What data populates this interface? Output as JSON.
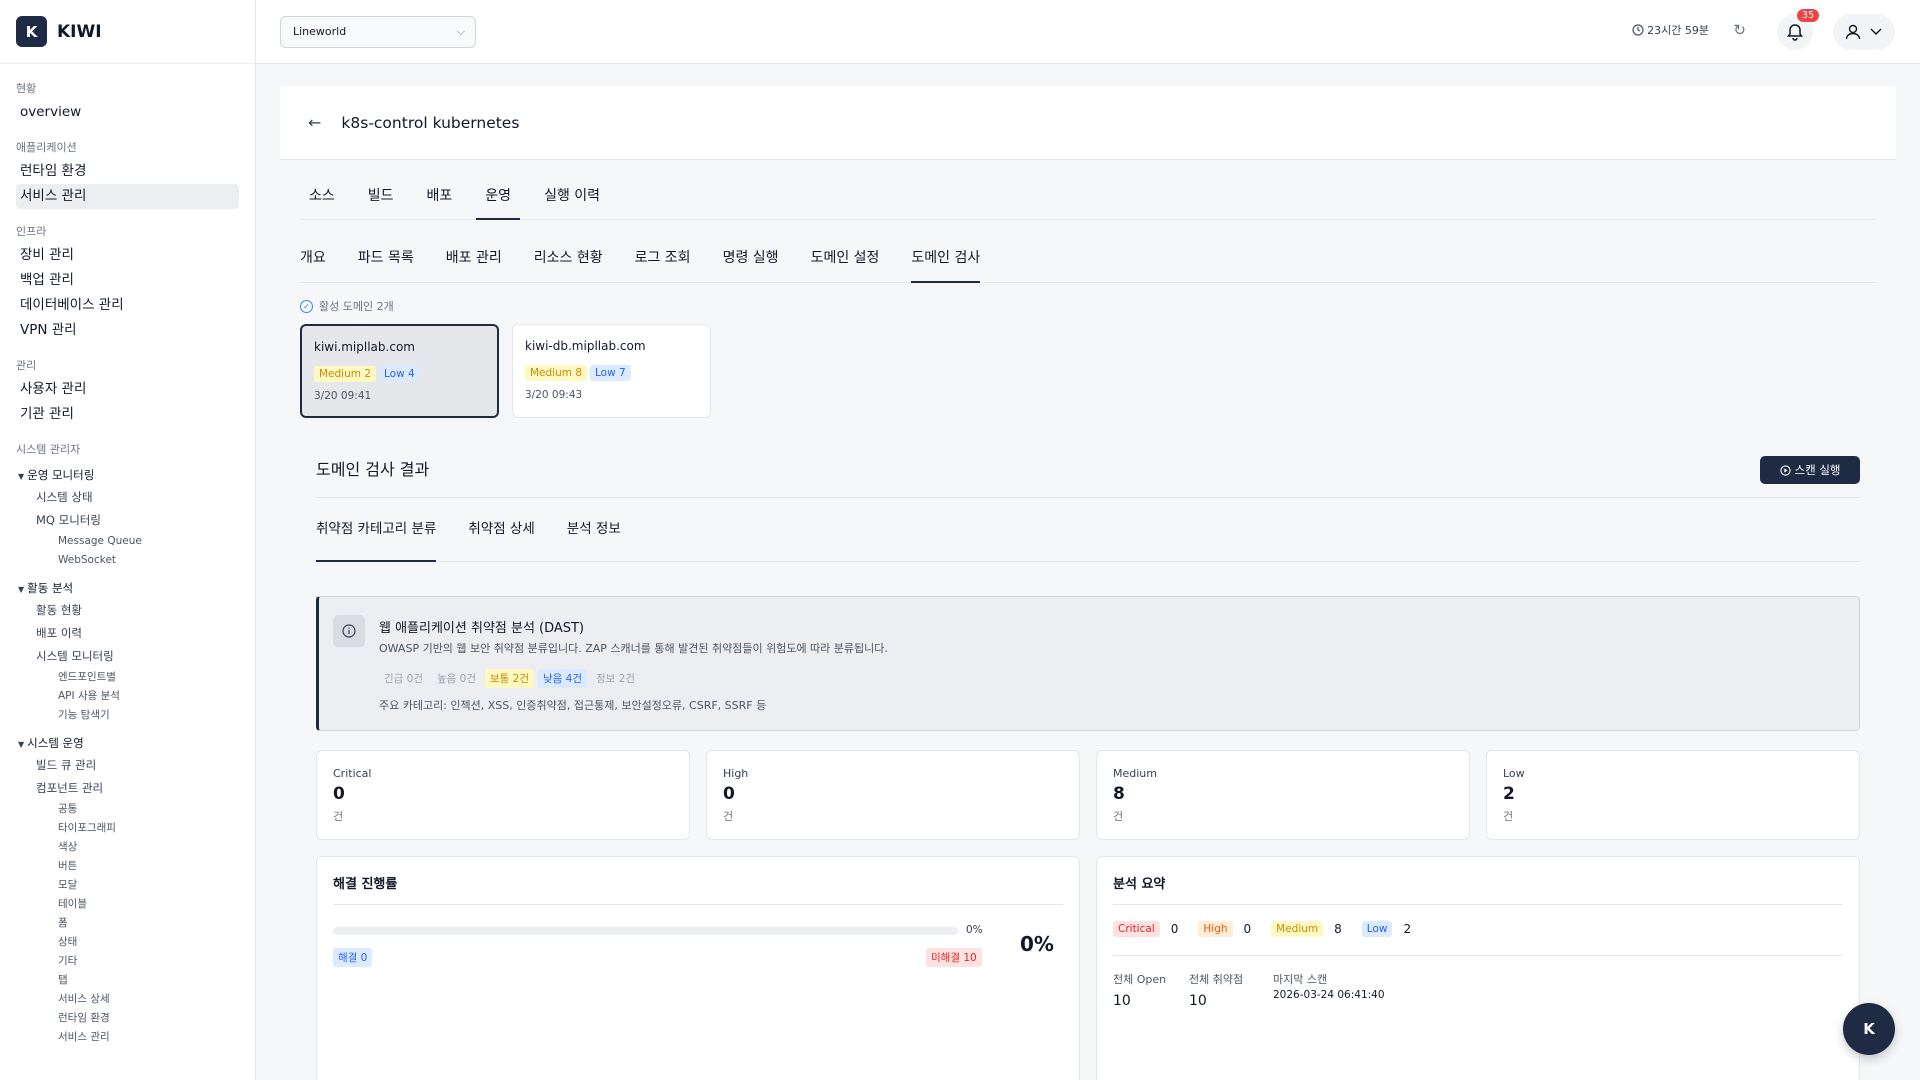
{
  "app": {
    "logo_letter": "K",
    "name": "KIWI"
  },
  "sidebar": {
    "sections": [
      {
        "label": "현황",
        "items": [
          "overview"
        ]
      },
      {
        "label": "애플리케이션",
        "items": [
          "런타임 환경",
          "서비스 관리"
        ]
      },
      {
        "label": "인프라",
        "items": [
          "장비 관리",
          "백업 관리",
          "데이터베이스 관리",
          "VPN 관리"
        ]
      },
      {
        "label": "관리",
        "items": [
          "사용자 관리",
          "기관 관리"
        ]
      }
    ],
    "admin_label": "시스템 관리자",
    "groups": [
      {
        "label": "운영 모니터링",
        "subs": [
          "시스템 상태",
          "MQ 모니터링"
        ],
        "subsubs": [
          "Message Queue",
          "WebSocket"
        ]
      },
      {
        "label": "활동 분석",
        "subs": [
          "활동 현황",
          "배포 이력",
          "시스템 모니터링"
        ],
        "subsubs": [
          "엔드포인트별",
          "API 사용 분석",
          "기능 탐색기"
        ]
      },
      {
        "label": "시스템 운영",
        "subs": [
          "빌드 큐 관리",
          "컴포넌트 관리"
        ],
        "subsubs": [
          "공통",
          "타이포그래피",
          "색상",
          "버튼",
          "모달",
          "테이블",
          "폼",
          "상태",
          "기타",
          "탭",
          "서비스 상세",
          "런타임 환경",
          "서비스 관리"
        ]
      }
    ]
  },
  "topbar": {
    "org": "Lineworld",
    "session": "23시간 59분",
    "notifications": "35"
  },
  "page": {
    "title": "k8s-control kubernetes",
    "tabs1": [
      "소스",
      "빌드",
      "배포",
      "운영",
      "실행 이력"
    ],
    "tabs2": [
      "개요",
      "파드 목록",
      "배포 관리",
      "리소스 현황",
      "로그 조회",
      "명령 실행",
      "도메인 설정",
      "도메인 검사"
    ],
    "active_domains": "활성 도메인 2개",
    "domains": [
      {
        "name": "kiwi.mipllab.com",
        "medium": "Medium 2",
        "low": "Low 4",
        "date": "3/20 09:41"
      },
      {
        "name": "kiwi-db.mipllab.com",
        "medium": "Medium 8",
        "low": "Low 7",
        "date": "3/20 09:43"
      }
    ],
    "results_title": "도메인 검사 결과",
    "scan_button": "스캔 실행",
    "tabs3": [
      "취약점 카테고리 분류",
      "취약점 상세",
      "분석 정보"
    ],
    "info": {
      "title": "웹 애플리케이션 취약점 분석 (DAST)",
      "desc": "OWASP 기반의 웹 보안 취약점 분류입니다. ZAP 스캐너를 통해 발견된 취약점들이 위험도에 따라 분류됩니다.",
      "chips": [
        "긴급 0건",
        "높음 0건",
        "보통 2건",
        "낮음 4건",
        "정보 2건"
      ],
      "cats": "주요 카테고리: 인젝션, XSS, 인증취약점, 접근통제, 보안설정오류, CSRF, SSRF 등"
    },
    "stats": [
      {
        "label": "Critical",
        "value": "0",
        "unit": "건"
      },
      {
        "label": "High",
        "value": "0",
        "unit": "건"
      },
      {
        "label": "Medium",
        "value": "8",
        "unit": "건"
      },
      {
        "label": "Low",
        "value": "2",
        "unit": "건"
      }
    ],
    "progress": {
      "title": "해결 진행률",
      "percent_value": 0,
      "percent_small": "0%",
      "percent_big": "0%",
      "resolved": "해결 0",
      "unresolved": "미해결 10"
    },
    "summary": {
      "title": "분석 요약",
      "levels": [
        {
          "label": "Critical",
          "count": "0"
        },
        {
          "label": "High",
          "count": "0"
        },
        {
          "label": "Medium",
          "count": "8"
        },
        {
          "label": "Low",
          "count": "2"
        }
      ],
      "open_label": "전체 Open",
      "open_value": "10",
      "total_label": "전체 취약점",
      "total_value": "10",
      "last_label": "마지막 스캔",
      "last_value": "2026-03-24 06:41:40"
    }
  },
  "fab": "K"
}
